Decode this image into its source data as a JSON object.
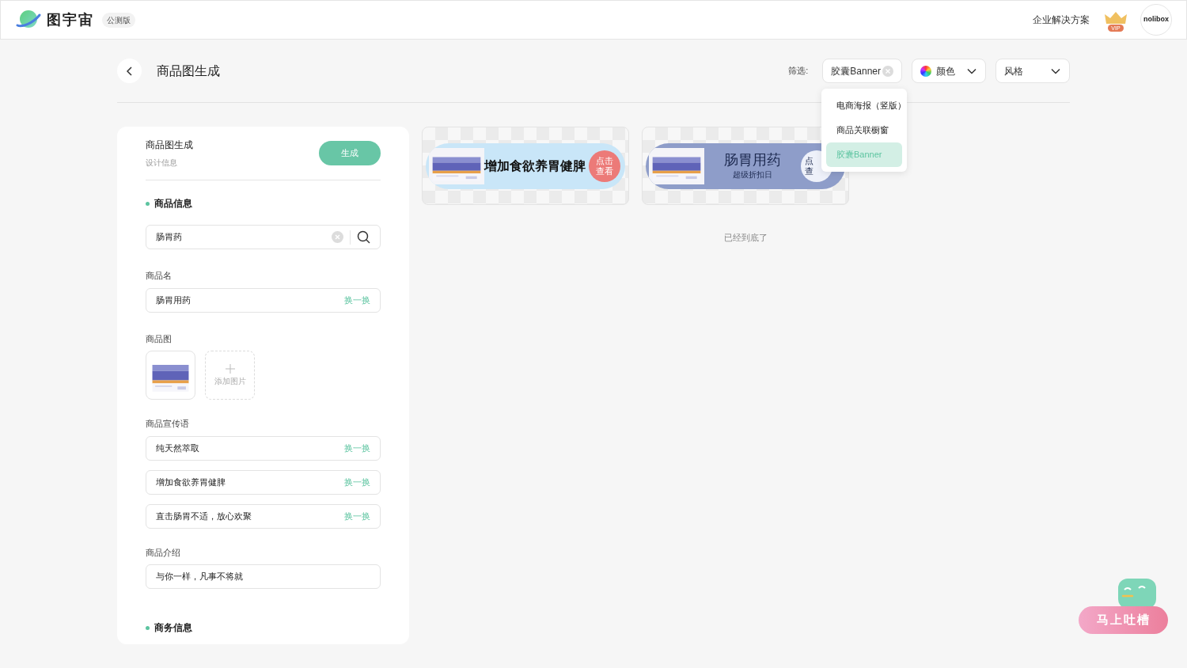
{
  "header": {
    "brand": "图宇宙",
    "badge": "公测版",
    "links": [
      "企业解决方案"
    ],
    "vip_label": "VIP",
    "avatar": "nolibox"
  },
  "page": {
    "title": "商品图生成"
  },
  "filters": {
    "label": "筛选:",
    "chips": [
      {
        "kind": "clearable",
        "label": "胶囊Banner"
      },
      {
        "kind": "color",
        "label": "颜色"
      },
      {
        "kind": "plain",
        "label": "风格"
      }
    ],
    "menu": {
      "items": [
        {
          "label": "电商海报（竖版）",
          "selected": false
        },
        {
          "label": "商品关联橱窗",
          "selected": false
        },
        {
          "label": "胶囊Banner",
          "selected": true
        }
      ]
    }
  },
  "form": {
    "title": "商品图生成",
    "subtitle": "设计信息",
    "generate": "生成",
    "section": "商品信息",
    "search_value": "肠胃药",
    "name_label": "商品名",
    "name_value": "肠胃用药",
    "name_swap": "换一换",
    "image_label": "商品图",
    "add_image": "添加图片",
    "slogan_label": "商品宣传语",
    "slogans": [
      {
        "text": "纯天然萃取",
        "swap": "换一换"
      },
      {
        "text": "增加食欲养胃健脾",
        "swap": "换一换"
      },
      {
        "text": "直击肠胃不适，放心欢聚",
        "swap": "换一换"
      }
    ],
    "intro_label": "商品介绍",
    "intro_value": "与你一样，凡事不将就",
    "section2": "商务信息"
  },
  "results": [
    {
      "kind": "light",
      "headline": "增加食欲养胃健脾",
      "cta": [
        "点击",
        "查看"
      ]
    },
    {
      "kind": "dark",
      "headline": "肠胃用药",
      "sub": "超级折扣日",
      "cta": [
        "点",
        "查"
      ]
    }
  ],
  "end_text": "已经到底了",
  "feedback": {
    "label": "马上吐槽"
  }
}
